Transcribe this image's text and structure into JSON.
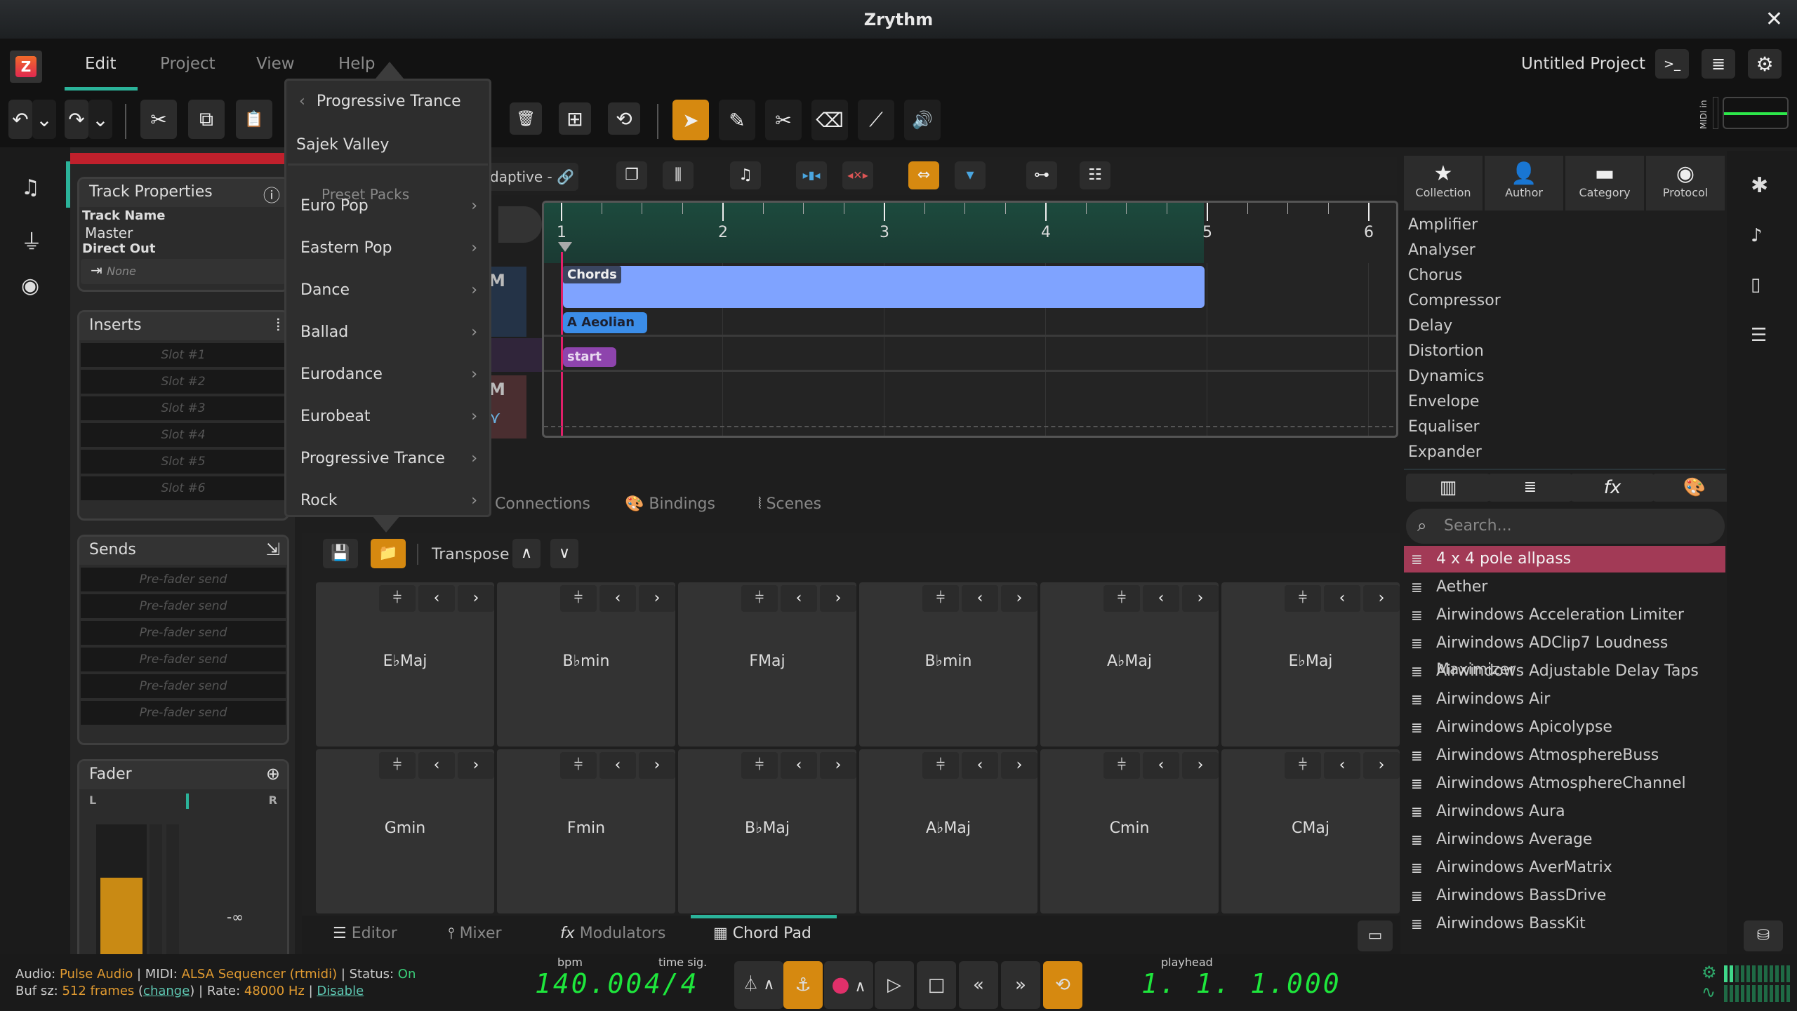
{
  "window": {
    "title": "Zrythm",
    "close": "✕"
  },
  "menu": {
    "items": [
      "Edit",
      "Project",
      "View",
      "Help"
    ],
    "active": "Edit",
    "project_name": "Untitled Project"
  },
  "toolbar": {
    "undo": "↶",
    "redo": "↷",
    "dropdown": "⌄",
    "cut": "✂",
    "copy": "⧉",
    "paste": "📋",
    "delete": "🗑",
    "select_all": "⊞",
    "loop": "⟲",
    "tools": {
      "select": "➤",
      "pencil": "✎",
      "cut": "✂",
      "eraser": "⌫",
      "ramp": "⟋",
      "audition": "🔊"
    },
    "right_icons": {
      "terminal": ">_",
      "log": "≣",
      "settings": "⚙"
    },
    "midi_in_label": "MIDI in"
  },
  "left_sidebar": {
    "icons": [
      "track-inspector-icon",
      "plug-icon",
      "eye-icon"
    ]
  },
  "track_properties": {
    "title": "Track Properties",
    "track_name_label": "Track Name",
    "track_name": "Master",
    "direct_out_label": "Direct Out",
    "direct_out_value": "None"
  },
  "inserts": {
    "title": "Inserts",
    "slots": [
      "Slot #1",
      "Slot #2",
      "Slot #3",
      "Slot #4",
      "Slot #5",
      "Slot #6"
    ]
  },
  "sends": {
    "title": "Sends",
    "slots": [
      "Pre-fader send",
      "Pre-fader send",
      "Pre-fader send",
      "Pre-fader send",
      "Pre-fader send",
      "Pre-fader send"
    ]
  },
  "fader": {
    "title": "Fader",
    "left": "L",
    "right": "R",
    "value": "-∞",
    "level": 0.62
  },
  "popover": {
    "back_title": "Progressive Trance",
    "selected_item": "Sajek Valley",
    "hidden_header": "Preset Packs",
    "items": [
      "Euro Pop",
      "Eastern Pop",
      "Dance",
      "Ballad",
      "Eurodance",
      "Eurobeat",
      "Progressive Trance",
      "Rock"
    ]
  },
  "timeline": {
    "snap_label": "daptive -",
    "bars": [
      "1",
      "2",
      "3",
      "4",
      "5",
      "6"
    ],
    "chords_region": "Chords",
    "scale_label": "A Aeolian",
    "marker_label": "start",
    "track_mute": "M"
  },
  "bottom_panel_tabs": [
    "Connections",
    "Bindings",
    "Scenes"
  ],
  "chord_pad": {
    "transpose_label": "Transpose",
    "row1": [
      "E♭Maj",
      "B♭min",
      "FMaj",
      "B♭min",
      "A♭Maj",
      "E♭Maj"
    ],
    "row2": [
      "Gmin",
      "Fmin",
      "B♭Maj",
      "A♭Maj",
      "Cmin",
      "CMaj"
    ]
  },
  "main_tabs": {
    "items": [
      "Editor",
      "Mixer",
      "Modulators",
      "Chord Pad"
    ],
    "active": "Chord Pad"
  },
  "status": {
    "audio_label": "Audio:",
    "audio_value": "Pulse Audio",
    "midi_label": "| MIDI:",
    "midi_value": "ALSA Sequencer (rtmidi)",
    "status_label": "| Status:",
    "status_value": "On",
    "buf_label": "Buf sz:",
    "buf_value": "512 frames",
    "change_link": "change",
    "rate_label": "| Rate:",
    "rate_value": "48000 Hz",
    "disable_link": "Disable"
  },
  "transport": {
    "bpm_label": "bpm",
    "bpm": "140.00",
    "timesig_label": "time sig.",
    "timesig": "4/4",
    "playhead_label": "playhead",
    "playhead": "1. 1. 1.000"
  },
  "browser": {
    "tabs": [
      {
        "icon": "★",
        "label": "Collection"
      },
      {
        "icon": "👤",
        "label": "Author"
      },
      {
        "icon": "▬",
        "label": "Category"
      },
      {
        "icon": "◉",
        "label": "Protocol"
      }
    ],
    "categories": [
      "Amplifier",
      "Analyser",
      "Chorus",
      "Compressor",
      "Delay",
      "Distortion",
      "Dynamics",
      "Envelope",
      "Equaliser",
      "Expander"
    ],
    "filter_icons": [
      "instrument-icon",
      "effect-icon",
      "fx-icon",
      "palette-icon"
    ],
    "search_placeholder": "Search...",
    "plugins": [
      "4 x 4 pole allpass",
      "Aether",
      "Airwindows Acceleration Limiter",
      "Airwindows ADClip7 Loudness Maximizer",
      "Airwindows Adjustable Delay Taps",
      "Airwindows Air",
      "Airwindows Apicolypse",
      "Airwindows AtmosphereBuss",
      "Airwindows AtmosphereChannel",
      "Airwindows Aura",
      "Airwindows Average",
      "Airwindows AverMatrix",
      "Airwindows BassDrive",
      "Airwindows BassKit"
    ],
    "selected_plugin": "4 x 4 pole allpass"
  },
  "meters": {
    "cpu_level": 0.15,
    "dsp_level": 0.0
  },
  "colors": {
    "accent": "#2bb39a",
    "orange": "#d68910",
    "chords": "#7fa3ff",
    "scale": "#3b8de8",
    "marker": "#8e44ad",
    "selected": "#a23a56",
    "lcd": "#1ee63c"
  }
}
